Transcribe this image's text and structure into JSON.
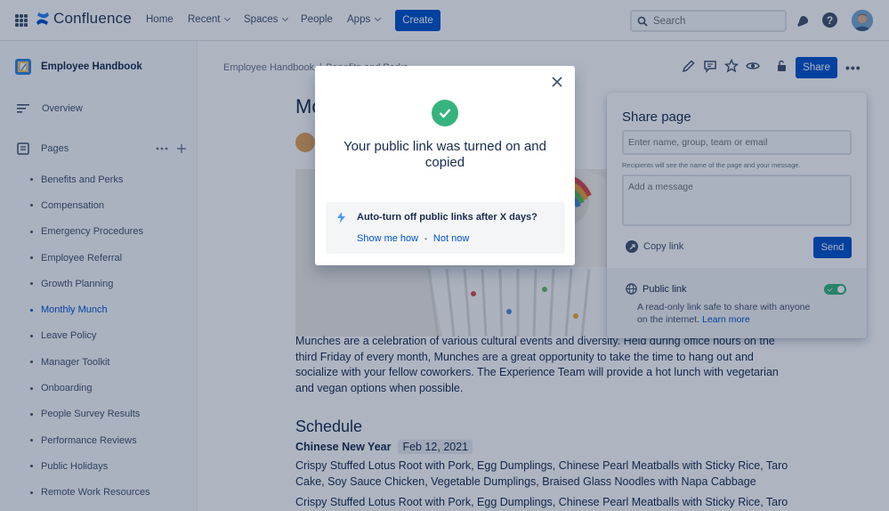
{
  "app": {
    "name": "Confluence",
    "brand_color": "#0052cc"
  },
  "topnav": {
    "items": [
      {
        "label": "Home"
      },
      {
        "label": "Recent"
      },
      {
        "label": "Spaces"
      },
      {
        "label": "People"
      },
      {
        "label": "Apps"
      }
    ],
    "create_label": "Create",
    "search_placeholder": "Search",
    "icons": [
      "grid-icon",
      "bell-icon",
      "help-icon",
      "avatar"
    ]
  },
  "sidebar": {
    "space_title": "Employee Handbook",
    "overview_label": "Overview",
    "pages_label": "Pages",
    "pages": [
      {
        "label": "Benefits and Perks"
      },
      {
        "label": "Compensation"
      },
      {
        "label": "Emergency Procedures"
      },
      {
        "label": "Employee Referral"
      },
      {
        "label": "Growth Planning"
      },
      {
        "label": "Monthly Munch",
        "active": true
      },
      {
        "label": "Leave Policy"
      },
      {
        "label": "Manager Toolkit"
      },
      {
        "label": "Onboarding"
      },
      {
        "label": "People Survey Results"
      },
      {
        "label": "Performance Reviews"
      },
      {
        "label": "Public Holidays"
      },
      {
        "label": "Remote Work Resources"
      }
    ]
  },
  "page": {
    "breadcrumb": [
      "Employee Handbook",
      "/",
      "Benefits and Perks"
    ],
    "title": "Mo",
    "share_label": "Share",
    "body": "Munches are a celebration of various cultural events and diversity. Held during office hours on the third Friday of every month, Munches are a great opportunity to take the time to hang out and socialize with your fellow coworkers. The Experience Team will provide a hot lunch with vegetarian and vegan options when possible.",
    "schedule_heading": "Schedule",
    "event_name": "Chinese New Year",
    "event_date": "Feb 12, 2021",
    "menu_1": "Crispy Stuffed Lotus Root with Pork, Egg Dumplings, Chinese Pearl Meatballs with Sticky Rice, Taro Cake, Soy Sauce Chicken, Vegetable Dumplings, Braised Glass Noodles with Napa Cabbage",
    "menu_2": "Crispy Stuffed Lotus Root with Pork, Egg Dumplings, Chinese Pearl Meatballs with Sticky Rice, Taro"
  },
  "share_panel": {
    "title": "Share page",
    "recipients_placeholder": "Enter name, group, team or email",
    "recipients_note": "Recipients will see the name of the page and your message.",
    "message_placeholder": "Add a message",
    "copy_link_label": "Copy link",
    "send_label": "Send",
    "public_link_label": "Public link",
    "public_link_on": true,
    "public_desc": "A read-only link safe to share with anyone on the internet.",
    "learn_more_label": "Learn more"
  },
  "modal": {
    "title": "Your public link was turned on and copied",
    "tip_text": "Auto-turn off public links after X days?",
    "show_me_how_label": "Show me how",
    "separator": "•",
    "not_now_label": "Not now",
    "success_color": "#36b37e"
  }
}
